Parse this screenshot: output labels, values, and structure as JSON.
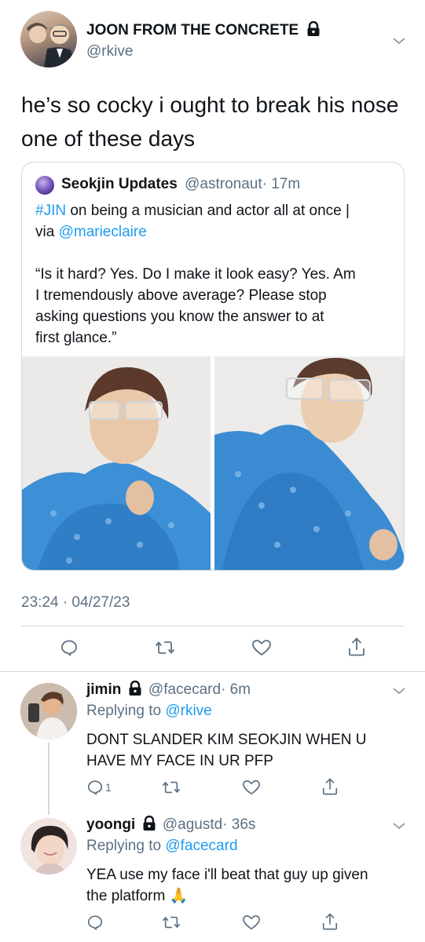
{
  "main_tweet": {
    "display_name": "JOON FROM THE CONCRETE",
    "handle": "@rkive",
    "text_line1": "he’s so cocky i ought to break his nose",
    "text_line2": "one of these days",
    "timestamp": "23:24 · 04/27/23"
  },
  "quoted_tweet": {
    "display_name": "Seokjin Updates",
    "handle": "@astronaut",
    "time": "· 17m",
    "hashtag": "#JIN",
    "line1_rest": " on being a musician and actor all at once |",
    "line2_pre": "via ",
    "mention": "@marieclaire",
    "quote_lines": [
      "“Is it hard? Yes. Do I make it look easy? Yes. Am",
      "I tremendously above average? Please stop",
      "asking questions you know the answer to at",
      "first glance.”"
    ]
  },
  "replies": [
    {
      "display_name": "jimin",
      "handle": "@facecard",
      "time": "· 6m",
      "replying_label": "Replying to ",
      "replying_to": "@rkive",
      "text_lines": [
        "DONT SLANDER KIM SEOKJIN WHEN U",
        "HAVE MY FACE IN UR PFP"
      ],
      "reply_count": "1"
    },
    {
      "display_name": "yoongi",
      "handle": "@agustd",
      "time": "· 36s",
      "replying_label": "Replying to ",
      "replying_to": "@facecard",
      "text_lines": [
        "YEA use my face i'll beat that guy up given",
        "the platform 🙏"
      ]
    }
  ],
  "icons": [
    "lock-icon",
    "chevron-down-icon",
    "reply-icon",
    "retweet-icon",
    "like-icon",
    "share-icon"
  ],
  "colors": {
    "link": "#1d9bf0",
    "muted": "#5b7083",
    "border": "#cfd9de",
    "text": "#0f1419"
  }
}
